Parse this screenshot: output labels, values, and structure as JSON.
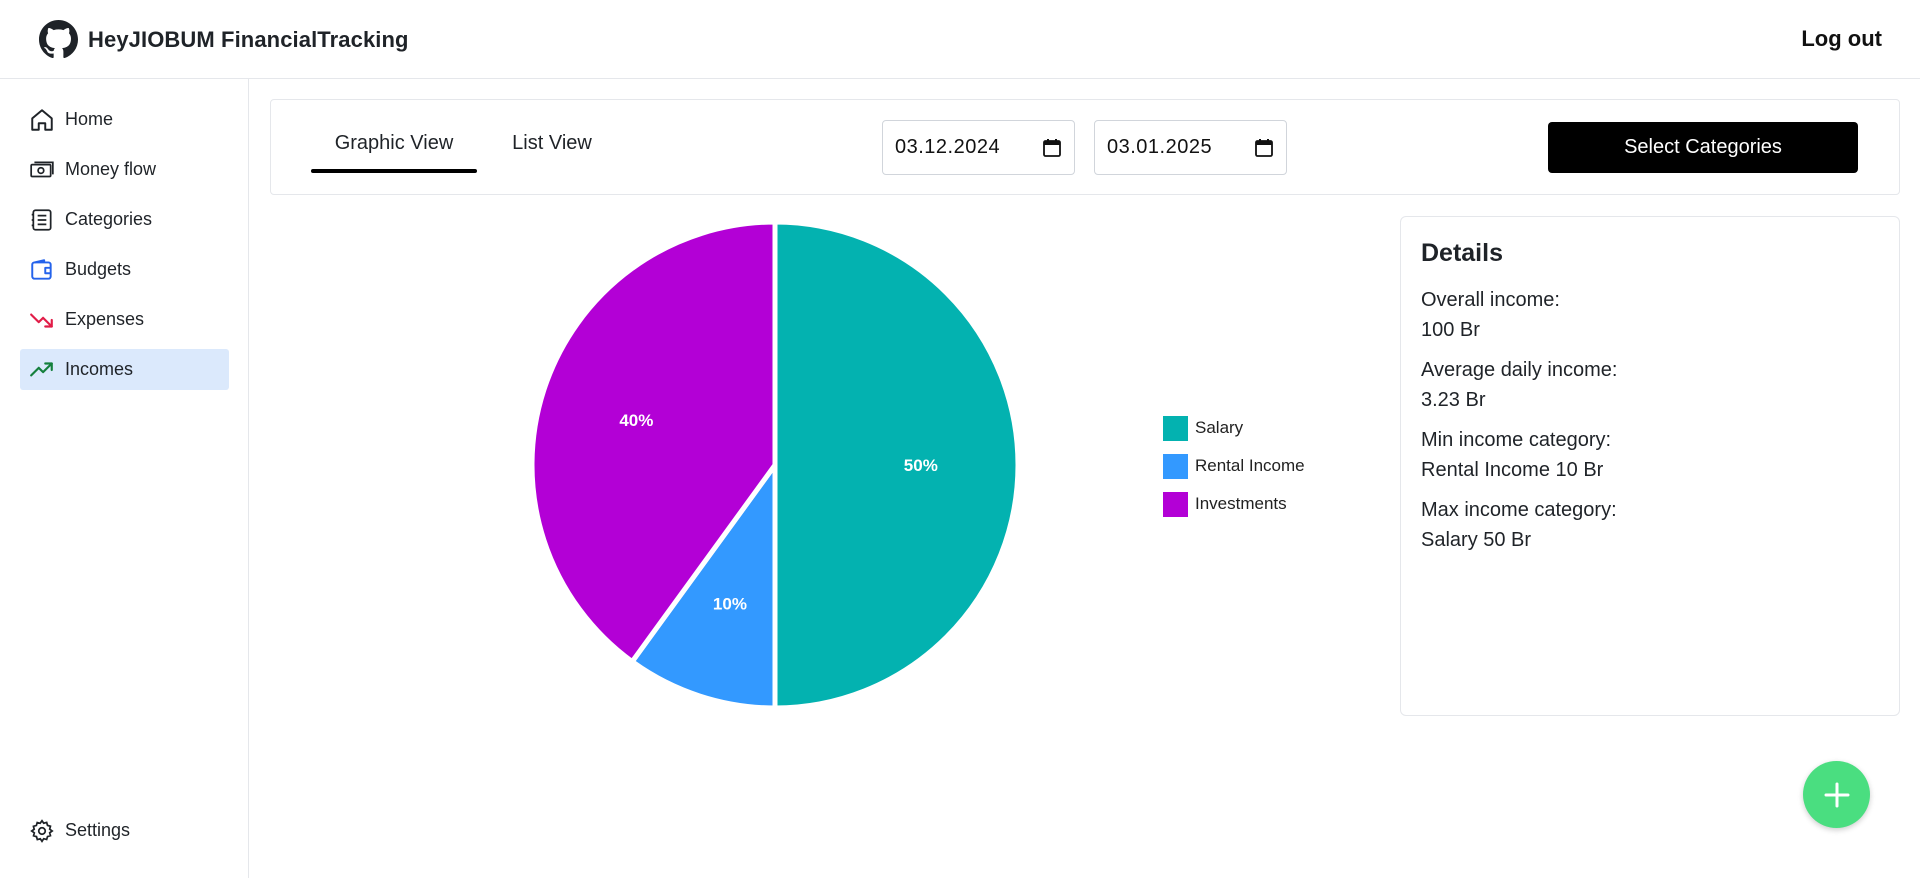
{
  "app": {
    "title": "HeyJIOBUM FinancialTracking",
    "logout_label": "Log out"
  },
  "sidebar": {
    "items": [
      {
        "label": "Home",
        "icon": "home-icon"
      },
      {
        "label": "Money flow",
        "icon": "money-icon"
      },
      {
        "label": "Categories",
        "icon": "list-icon"
      },
      {
        "label": "Budgets",
        "icon": "wallet-icon"
      },
      {
        "label": "Expenses",
        "icon": "trending-down-icon"
      },
      {
        "label": "Incomes",
        "icon": "trending-up-icon"
      }
    ],
    "active": "Incomes",
    "settings_label": "Settings"
  },
  "toolbar": {
    "tabs": [
      "Graphic View",
      "List View"
    ],
    "active_tab": "Graphic View",
    "date_from": "03.12.2024",
    "date_to": "03.01.2025",
    "select_categories_label": "Select Categories"
  },
  "chart_data": {
    "type": "pie",
    "categories": [
      "Salary",
      "Rental Income",
      "Investments"
    ],
    "values": [
      50,
      10,
      40
    ],
    "labels": [
      "50%",
      "10%",
      "40%"
    ],
    "colors": [
      "#03b2b0",
      "#3399ff",
      "#b300d6"
    ],
    "legend_position": "right"
  },
  "details": {
    "title": "Details",
    "overall_income_label": "Overall income:",
    "overall_income_value": "100 Br",
    "avg_daily_label": "Average daily income:",
    "avg_daily_value": "3.23 Br",
    "min_category_label": "Min income category:",
    "min_category_value": "Rental Income 10 Br",
    "max_category_label": "Max income category:",
    "max_category_value": "Salary 50 Br"
  },
  "colors": {
    "accent_active_bg": "#dbe9fc",
    "fab": "#4ade80",
    "expenses_icon": "#e11d48",
    "incomes_icon": "#15803d",
    "budgets_icon": "#2563eb"
  }
}
